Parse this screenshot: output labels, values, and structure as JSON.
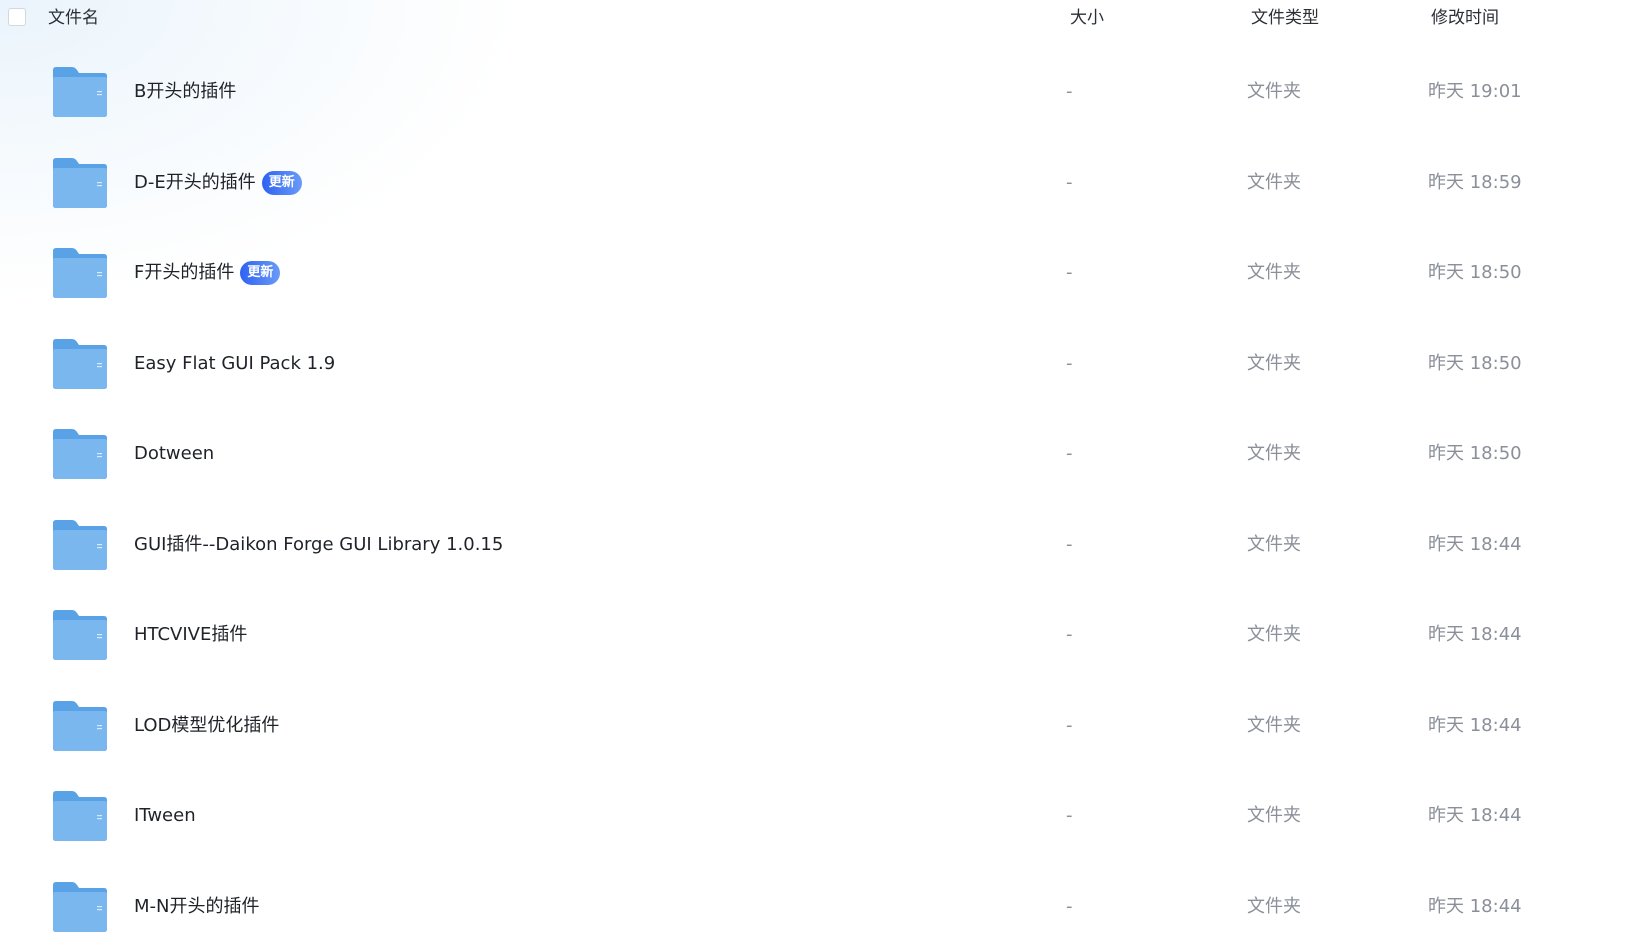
{
  "header": {
    "name": "文件名",
    "size": "大小",
    "type": "文件类型",
    "time": "修改时间"
  },
  "colors": {
    "folder_front": "#7ab7ee",
    "folder_back": "#5aa2e6",
    "badge_start": "#2e63f2",
    "badge_end": "#6a9af8",
    "muted_text": "#8a8f99"
  },
  "files": [
    {
      "name": "B开头的插件",
      "badge": "",
      "size": "-",
      "type": "文件夹",
      "time": "昨天 19:01",
      "icon": "folder-icon"
    },
    {
      "name": "D-E开头的插件",
      "badge": "更新",
      "size": "-",
      "type": "文件夹",
      "time": "昨天 18:59",
      "icon": "folder-icon"
    },
    {
      "name": "F开头的插件",
      "badge": "更新",
      "size": "-",
      "type": "文件夹",
      "time": "昨天 18:50",
      "icon": "folder-icon"
    },
    {
      "name": "Easy Flat GUI Pack 1.9",
      "badge": "",
      "size": "-",
      "type": "文件夹",
      "time": "昨天 18:50",
      "icon": "folder-icon"
    },
    {
      "name": "Dotween",
      "badge": "",
      "size": "-",
      "type": "文件夹",
      "time": "昨天 18:50",
      "icon": "folder-icon"
    },
    {
      "name": "GUI插件--Daikon Forge GUI Library 1.0.15",
      "badge": "",
      "size": "-",
      "type": "文件夹",
      "time": "昨天 18:44",
      "icon": "folder-icon"
    },
    {
      "name": "HTCVIVE插件",
      "badge": "",
      "size": "-",
      "type": "文件夹",
      "time": "昨天 18:44",
      "icon": "folder-icon"
    },
    {
      "name": "LOD模型优化插件",
      "badge": "",
      "size": "-",
      "type": "文件夹",
      "time": "昨天 18:44",
      "icon": "folder-icon"
    },
    {
      "name": "ITween",
      "badge": "",
      "size": "-",
      "type": "文件夹",
      "time": "昨天 18:44",
      "icon": "folder-icon"
    },
    {
      "name": "M-N开头的插件",
      "badge": "",
      "size": "-",
      "type": "文件夹",
      "time": "昨天 18:44",
      "icon": "folder-icon"
    }
  ]
}
